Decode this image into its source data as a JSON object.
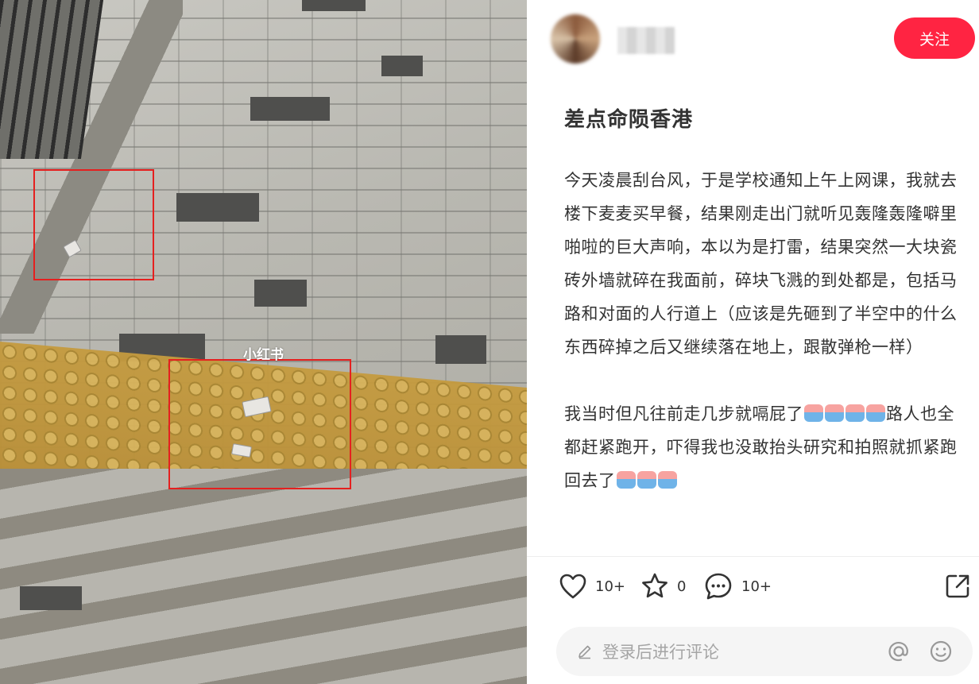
{
  "photo": {
    "watermark": "小红书"
  },
  "author": {
    "follow_label": "关注"
  },
  "post": {
    "title": "差点命陨香港",
    "paragraph1": "今天凌晨刮台风，于是学校通知上午上网课，我就去楼下麦麦买早餐，结果刚走出门就听见轰隆轰隆噼里啪啦的巨大声响，本以为是打雷，结果突然一大块瓷砖外墙就碎在我面前，碎块飞溅的到处都是，包括马路和对面的人行道上（应该是先砸到了半空中的什么东西碎掉之后又继续落在地上，跟散弹枪一样）",
    "paragraph2_a": "我当时但凡往前走几步就嗝屁了",
    "paragraph2_b": "路人也全都赶紧跑开，吓得我也没敢抬头研究和拍照就抓紧跑回去了",
    "emoji_name": "crying-emoji"
  },
  "actions": {
    "like_count": "10+",
    "collect_count": "0",
    "comment_count": "10+"
  },
  "comment": {
    "placeholder": "登录后进行评论"
  },
  "colors": {
    "accent": "#ff2442",
    "highlight_box": "#e5201f"
  }
}
